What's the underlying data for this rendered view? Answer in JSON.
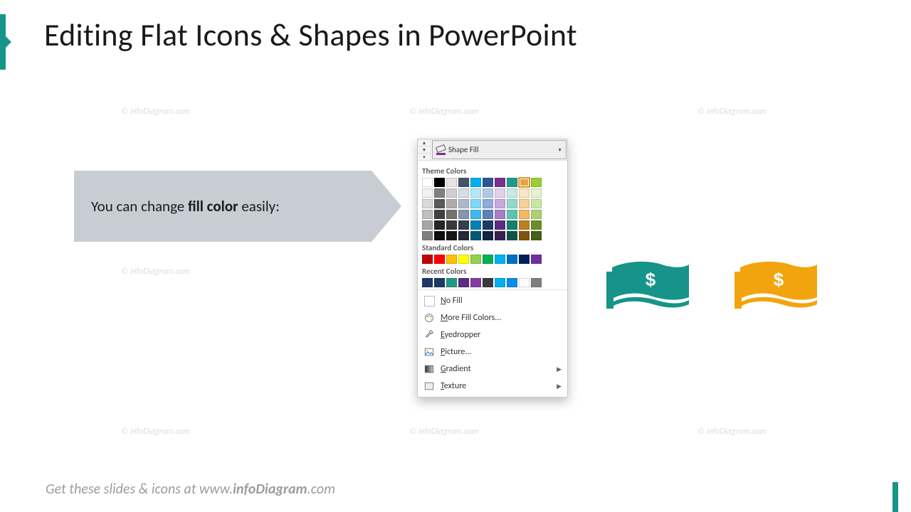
{
  "title": "Editing Flat Icons & Shapes in PowerPoint",
  "callout": {
    "pre": "You can change ",
    "bold": "fill color",
    "post": " easily:"
  },
  "dropdown": {
    "button_label": "Shape Fill",
    "section_theme": "Theme Colors",
    "section_standard": "Standard Colors",
    "section_recent": "Recent Colors",
    "theme_row1": [
      "#ffffff",
      "#000000",
      "#e7e6e6",
      "#44546a",
      "#00b0f0",
      "#2f5597",
      "#7b2f8f",
      "#1f9b88",
      "#e8a23f",
      "#9acd32"
    ],
    "theme_shades": [
      [
        "#f2f2f2",
        "#808080",
        "#d0cece",
        "#d6dce5",
        "#b3e7fb",
        "#b4c7e7",
        "#e2cff0",
        "#c3ebe4",
        "#fbe5c5",
        "#e4f3cf"
      ],
      [
        "#d9d9d9",
        "#595959",
        "#aeabab",
        "#adb9ca",
        "#7fd6f7",
        "#8faadc",
        "#c8a8dd",
        "#93d8cb",
        "#f7cf97",
        "#c9e7a1"
      ],
      [
        "#bfbfbf",
        "#404040",
        "#757171",
        "#8496b0",
        "#3eb9eb",
        "#5b7fbf",
        "#a97cc7",
        "#5cc5b3",
        "#f2b75f",
        "#add272"
      ],
      [
        "#a6a6a6",
        "#262626",
        "#3b3838",
        "#333f50",
        "#0083b3",
        "#1f3864",
        "#5b2d87",
        "#13806e",
        "#bf7e1f",
        "#6a8f29"
      ],
      [
        "#808080",
        "#0d0d0d",
        "#171717",
        "#222a35",
        "#005a7a",
        "#132540",
        "#3a1c56",
        "#0b5548",
        "#7f540f",
        "#465f1b"
      ]
    ],
    "standard": [
      "#c00000",
      "#ff0000",
      "#ffc000",
      "#ffff00",
      "#92d050",
      "#00b050",
      "#00b0f0",
      "#0070c0",
      "#002060",
      "#7030a0"
    ],
    "recent": [
      "#1f3864",
      "#203864",
      "#1f9b88",
      "#5b2d87",
      "#833c9f",
      "#3a3a3a",
      "#00b0f0",
      "#0c8ce9",
      "#ffffff",
      "#7f7f7f"
    ],
    "selected_index": 8,
    "no_fill": {
      "u": "N",
      "rest": "o Fill"
    },
    "more_colors": {
      "u": "M",
      "rest": "ore Fill Colors..."
    },
    "eyedropper": {
      "u": "E",
      "rest": "yedropper"
    },
    "picture": {
      "u": "P",
      "rest": "icture..."
    },
    "gradient": {
      "u": "G",
      "rest": "radient"
    },
    "texture": {
      "u": "T",
      "rest": "exture"
    }
  },
  "watermark": "© infoDiagram.com",
  "footer": {
    "pre": "Get these slides & icons at www.",
    "bold": "infoDiagram",
    "post": ".com"
  },
  "colors": {
    "teal": "#169489",
    "orange": "#f2a40e"
  }
}
